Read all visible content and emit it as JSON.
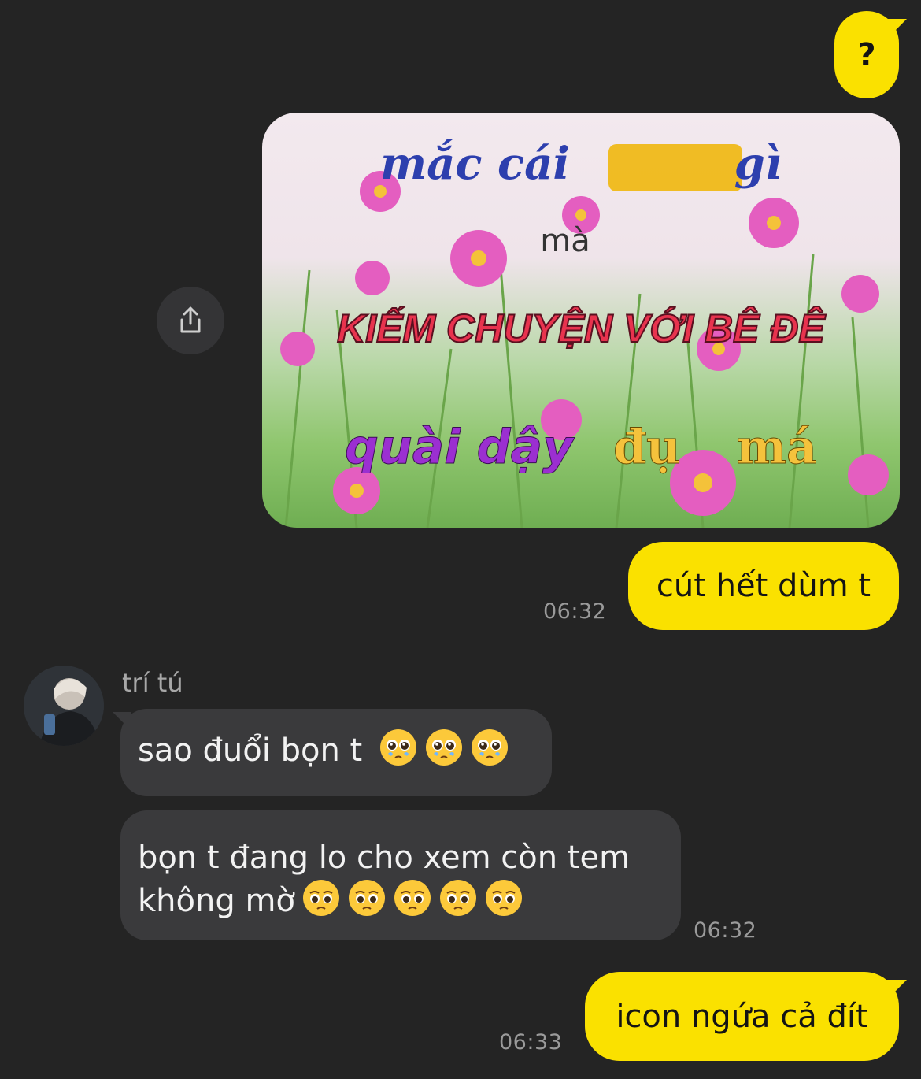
{
  "messages": {
    "m1": {
      "text": "?"
    },
    "image": {
      "line1": "mắc cái",
      "line1_tail": "gì",
      "line2": "mà",
      "line3": "KIẾM CHUYỆN VỚI BÊ ĐÊ",
      "line4a": "quài dậy",
      "line4b": "đụ",
      "line4c": "má"
    },
    "m2": {
      "text": "cút hết dùm t",
      "time": "06:32"
    },
    "sender": {
      "name": "trí tú"
    },
    "m3": {
      "text": "sao đuổi bọn t"
    },
    "m4": {
      "line1": "bọn t đang lo cho xem còn tem",
      "line2": "không mờ",
      "time": "06:32"
    },
    "m5": {
      "text": "icon ngứa cả đít",
      "time": "06:33"
    }
  },
  "icons": {
    "share": "share-icon",
    "pleading": "pleading-face-emoji"
  },
  "colors": {
    "background": "#242424",
    "outgoing_bubble": "#fae100",
    "incoming_bubble": "#3a3a3c",
    "timestamp": "#9a9a9a"
  }
}
